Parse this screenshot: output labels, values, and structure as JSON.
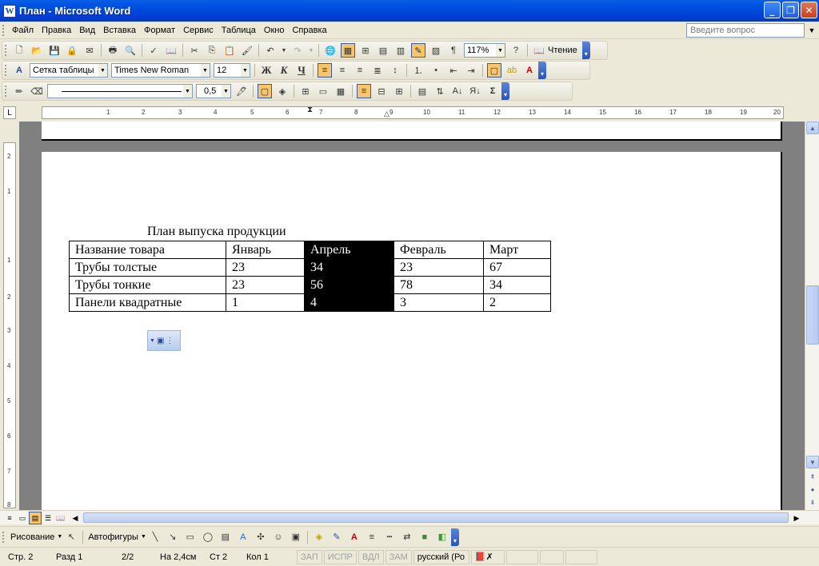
{
  "window": {
    "title": "План - Microsoft Word",
    "app_icon": "W"
  },
  "menu": [
    "Файл",
    "Правка",
    "Вид",
    "Вставка",
    "Формат",
    "Сервис",
    "Таблица",
    "Окно",
    "Справка"
  ],
  "ask": {
    "placeholder": "Введите вопрос"
  },
  "standard": {
    "zoom": "117%",
    "read_label": "Чтение"
  },
  "formatting": {
    "style": "Сетка таблицы",
    "font": "Times New Roman",
    "size": "12",
    "bold": "Ж",
    "italic": "К",
    "underline": "Ч"
  },
  "tables_tb": {
    "line_weight": "0,5"
  },
  "ruler": {
    "h_numbers": [
      "1",
      "2",
      "3",
      "4",
      "5",
      "6",
      "7",
      "8",
      "9",
      "10",
      "11",
      "12",
      "13",
      "14",
      "15",
      "16",
      "17",
      "18",
      "19",
      "20"
    ],
    "v_numbers": [
      "2",
      "1",
      "1",
      "2",
      "3",
      "4",
      "5",
      "6",
      "7",
      "8"
    ]
  },
  "document": {
    "title": "План выпуска продукции",
    "table": {
      "headers": [
        "Название товара",
        "Январь",
        "Апрель",
        "Февраль",
        "Март"
      ],
      "rows": [
        [
          "Трубы толстые",
          "23",
          "34",
          "23",
          "67"
        ],
        [
          "Трубы тонкие",
          "23",
          "56",
          "78",
          "34"
        ],
        [
          "Панели квадратные",
          "1",
          "4",
          "3",
          "2"
        ]
      ]
    }
  },
  "drawing": {
    "draw_label": "Рисование",
    "autoshapes_label": "Автофигуры"
  },
  "status": {
    "page": "Стр. 2",
    "section": "Разд 1",
    "pages": "2/2",
    "at": "На 2,4см",
    "line": "Ст 2",
    "col": "Кол 1",
    "rec": "ЗАП",
    "trk": "ИСПР",
    "ext": "ВДЛ",
    "ovr": "ЗАМ",
    "lang": "русский (Ро"
  },
  "colors": {
    "title_bar": "#0054e3",
    "highlight": "#f6c56e",
    "selected_column": "#000000"
  }
}
